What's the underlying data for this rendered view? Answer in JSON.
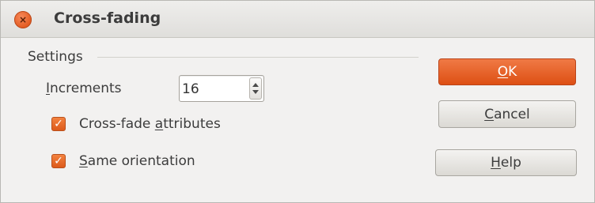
{
  "window": {
    "title": "Cross-fading",
    "close_icon": "close-icon"
  },
  "settings": {
    "section_label": "Settings",
    "increments": {
      "label_underlined": "I",
      "label_rest": "ncrements",
      "value": "16"
    },
    "cross_fade_attributes": {
      "label_before": "Cross-fade ",
      "label_underlined": "a",
      "label_after": "ttributes",
      "checked": true
    },
    "same_orientation": {
      "label_underlined": "S",
      "label_after": "ame orientation",
      "checked": true
    }
  },
  "buttons": {
    "ok": {
      "underlined": "O",
      "rest": "K"
    },
    "cancel": {
      "underlined": "C",
      "rest": "ancel"
    },
    "help": {
      "underlined": "H",
      "rest": "elp"
    }
  },
  "colors": {
    "accent": "#e25a1f",
    "background": "#f2f1f0"
  }
}
